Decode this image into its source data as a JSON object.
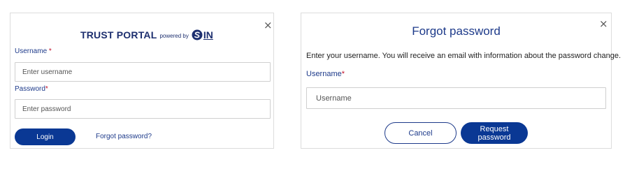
{
  "login": {
    "close_symbol": "×",
    "brand": {
      "title": "TRUST PORTAL",
      "powered_by": "powered by",
      "logo_text": "IN",
      "logo_icon": "s-circle-logo-icon"
    },
    "username_label": "Username",
    "password_label": "Password",
    "required_marker": "*",
    "username_placeholder": "Enter username",
    "password_placeholder": "Enter password",
    "login_button": "Login",
    "forgot_link": "Forgot password?"
  },
  "forgot": {
    "close_symbol": "×",
    "title": "Forgot password",
    "description": "Enter your username. You will receive an email with information about the password change.",
    "username_label": "Username",
    "required_marker": "*",
    "username_placeholder": "Username",
    "cancel_button": "Cancel",
    "request_button": "Request password"
  },
  "colors": {
    "primary": "#0a3894",
    "brand_text": "#1d2f6f",
    "label_text": "#1d3a8a",
    "required": "#c0102a"
  }
}
